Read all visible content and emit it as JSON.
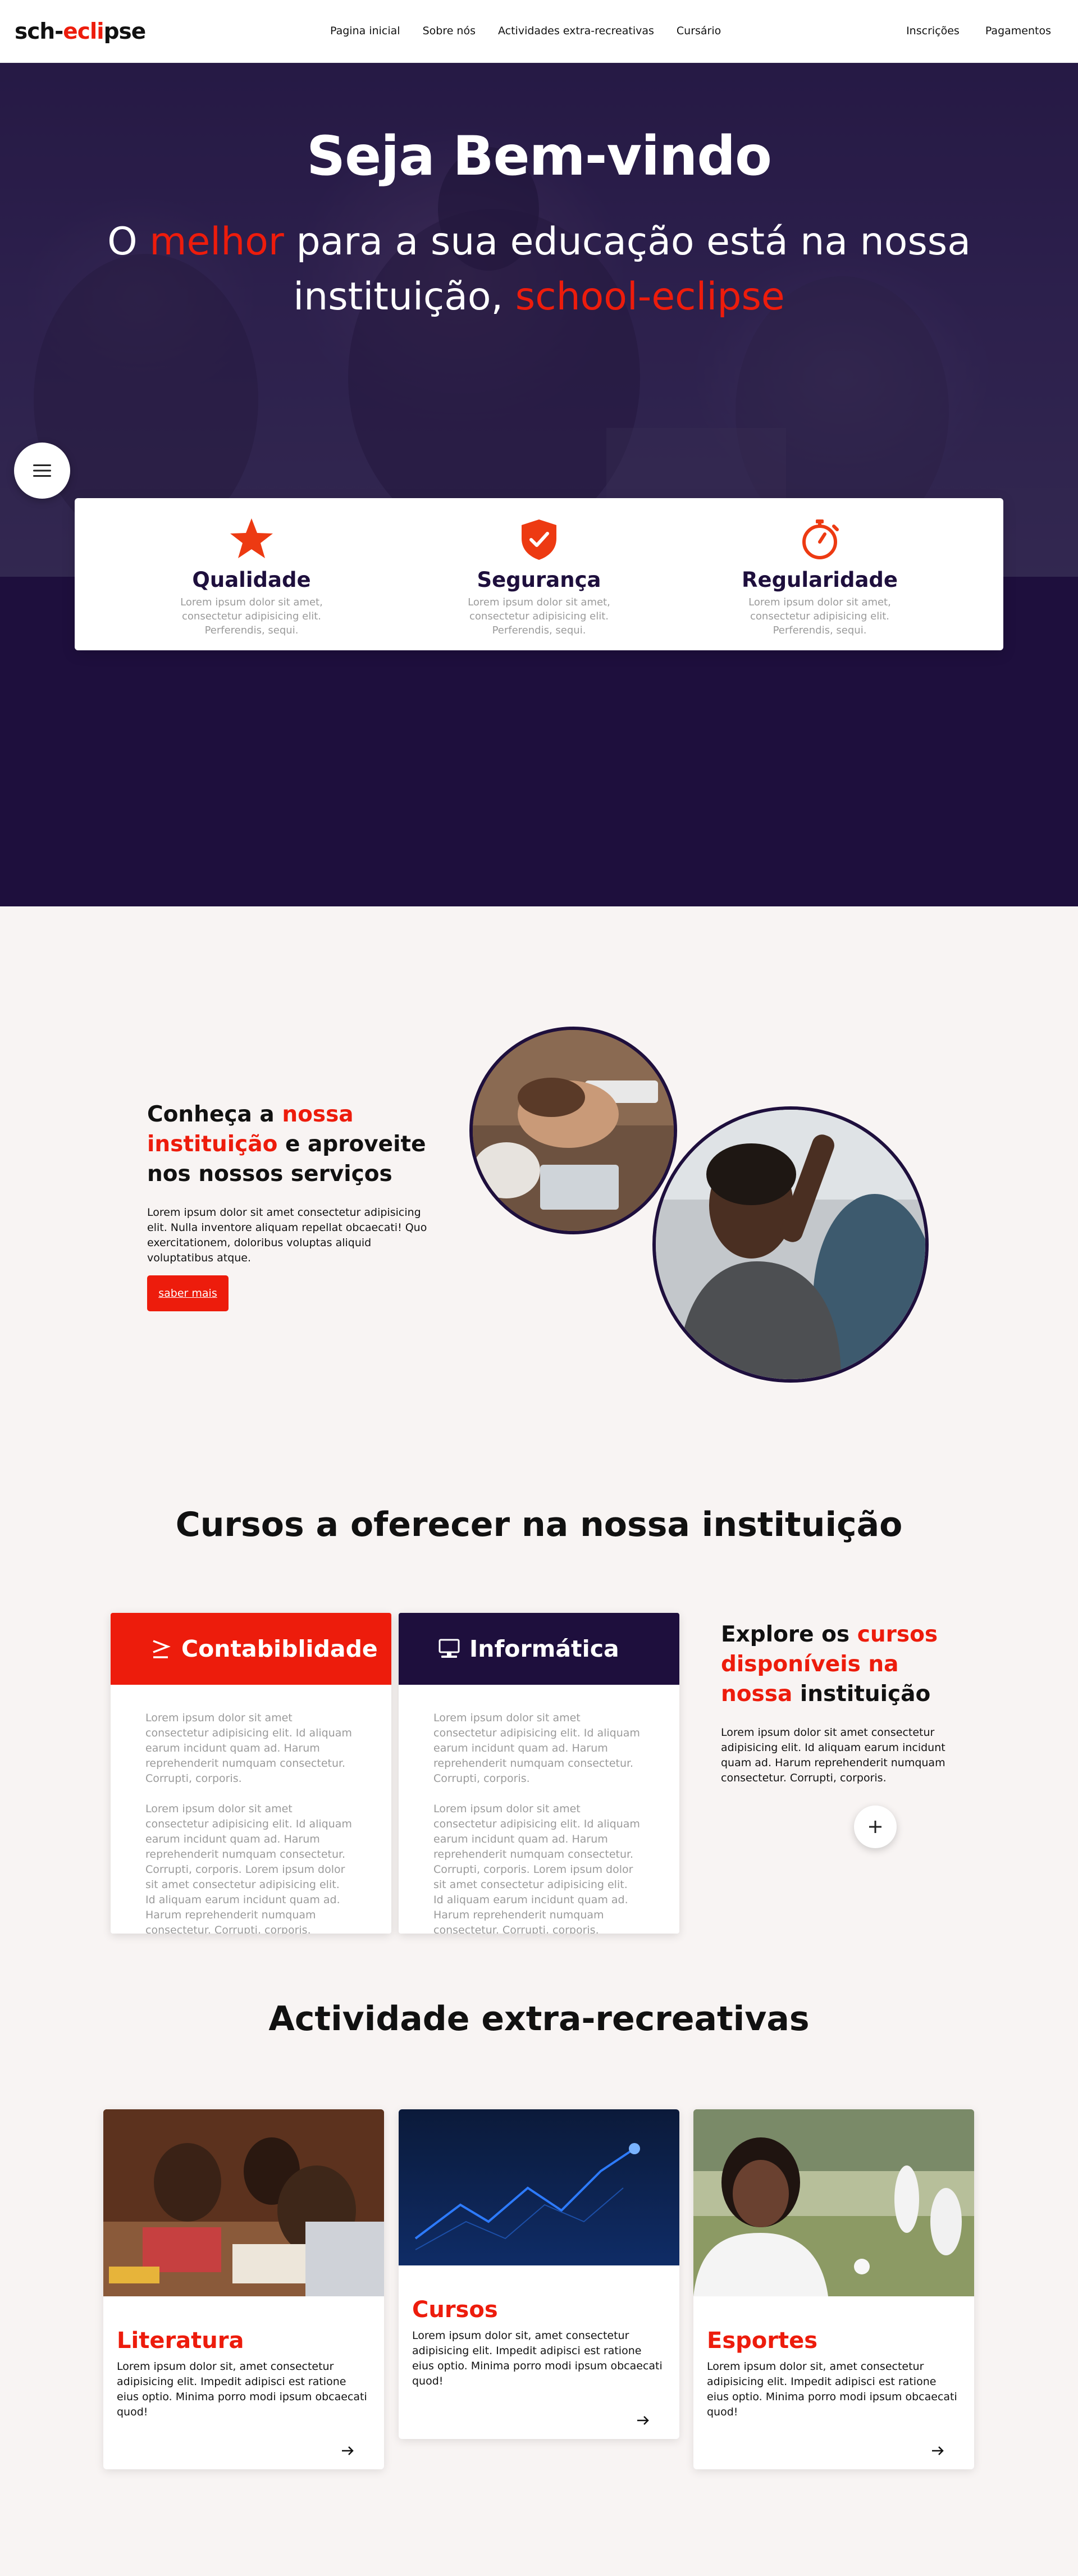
{
  "nav": {
    "logo_a": "sch-",
    "logo_b": "ecli",
    "logo_c": "pse",
    "links": [
      "Pagina inicial",
      "Sobre nós",
      "Actividades extra-recreativas",
      "Cursário"
    ],
    "right_links": [
      "Inscrições",
      "Pagamentos"
    ]
  },
  "hero": {
    "title": "Seja Bem-vindo",
    "subtitle_1": "O ",
    "subtitle_highlight_1": "melhor",
    "subtitle_2": " para a sua educação está na nossa instituição, ",
    "subtitle_highlight_2": "school-eclipse"
  },
  "features": [
    {
      "icon": "star-icon",
      "title": "Qualidade",
      "text": "Lorem ipsum dolor sit amet, consectetur adipisicing elit. Perferendis, sequi."
    },
    {
      "icon": "shield-check-icon",
      "title": "Segurança",
      "text": "Lorem ipsum dolor sit amet, consectetur adipisicing elit. Perferendis, sequi."
    },
    {
      "icon": "stopwatch-icon",
      "title": "Regularidade",
      "text": "Lorem ipsum dolor sit amet, consectetur adipisicing elit. Perferendis, sequi."
    }
  ],
  "about": {
    "title_1": "Conheça a ",
    "title_highlight": "nossa instituição",
    "title_2": " e aproveite nos nossos serviços",
    "text": "Lorem ipsum dolor sit amet consectetur adipisicing elit. Nulla inventore aliquam repellat obcaecati! Quo exercitationem, doloribus voluptas aliquid voluptatibus atque.",
    "button": "saber mais"
  },
  "courses": {
    "title": "Cursos a oferecer na nossa instituição",
    "cards": [
      {
        "title": "Contabiblidade",
        "p1": "Lorem ipsum dolor sit amet consectetur adipisicing elit. Id aliquam earum incidunt quam ad. Harum reprehenderit numquam consectetur. Corrupti, corporis.",
        "p2": "Lorem ipsum dolor sit amet consectetur adipisicing elit. Id aliquam earum incidunt quam ad. Harum reprehenderit numquam consectetur. Corrupti, corporis. Lorem ipsum dolor sit amet consectetur adipisicing elit. Id aliquam earum incidunt quam ad. Harum reprehenderit numquam consectetur. Corrupti, corporis."
      },
      {
        "title": "Informática",
        "p1": "Lorem ipsum dolor sit amet consectetur adipisicing elit. Id aliquam earum incidunt quam ad. Harum reprehenderit numquam consectetur. Corrupti, corporis.",
        "p2": "Lorem ipsum dolor sit amet consectetur adipisicing elit. Id aliquam earum incidunt quam ad. Harum reprehenderit numquam consectetur. Corrupti, corporis. Lorem ipsum dolor sit amet consectetur adipisicing elit. Id aliquam earum incidunt quam ad. Harum reprehenderit numquam consectetur. Corrupti, corporis."
      }
    ],
    "explore_1": "Explore os ",
    "explore_highlight": "cursos disponíveis na nossa",
    "explore_2": " instituição",
    "explore_text": "Lorem ipsum dolor sit amet consectetur adipisicing elit. Id aliquam earum incidunt quam ad. Harum reprehenderit numquam consectetur. Corrupti, corporis."
  },
  "activities": {
    "title": "Actividade extra-recreativas",
    "cards": [
      {
        "title": "Literatura",
        "text": "Lorem ipsum dolor sit, amet consectetur adipisicing elit. Impedit adipisci est ratione eius optio. Minima porro modi ipsum obcaecati quod!"
      },
      {
        "title": "Cursos",
        "text": "Lorem ipsum dolor sit, amet consectetur adipisicing elit. Impedit adipisci est ratione eius optio. Minima porro modi ipsum obcaecati quod!"
      },
      {
        "title": "Esportes",
        "text": "Lorem ipsum dolor sit, amet consectetur adipisicing elit. Impedit adipisci est ratione eius optio. Minima porro modi ipsum obcaecati quod!"
      }
    ]
  },
  "colors": {
    "accent": "#ed1c0c",
    "dark": "#1e0f3d",
    "background": "#f8f4f3"
  }
}
